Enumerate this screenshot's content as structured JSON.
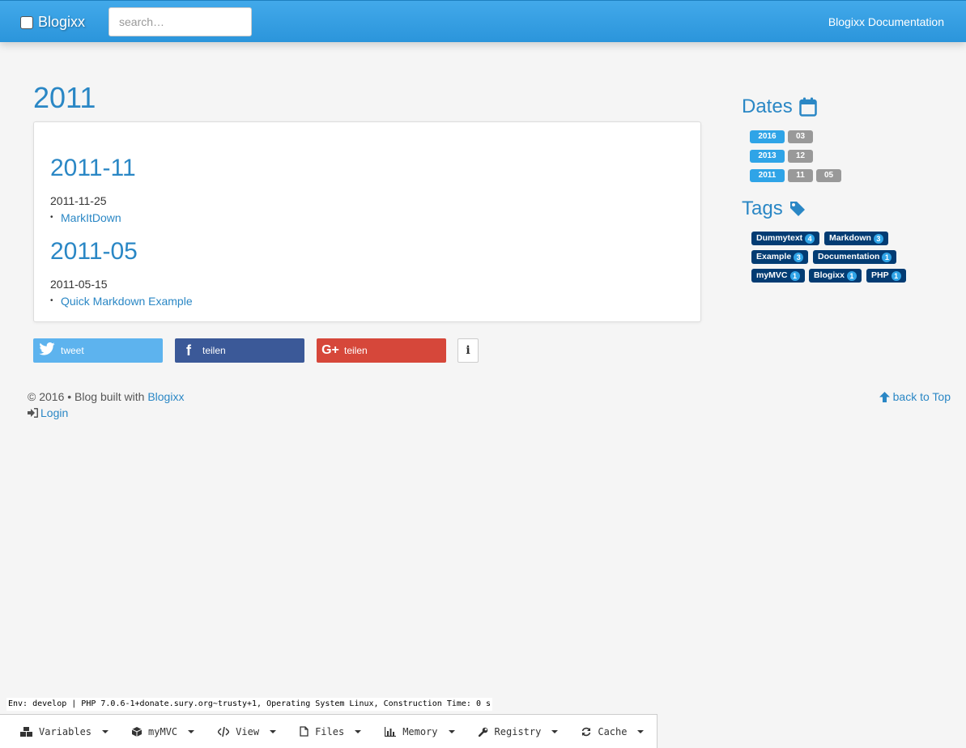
{
  "navbar": {
    "brand": "Blogixx",
    "search_placeholder": "search…",
    "doc_link": "Blogixx Documentation"
  },
  "page_title": "2011",
  "archive": [
    {
      "heading": "2011-11",
      "date": "2011-11-25",
      "posts": [
        "MarkItDown"
      ]
    },
    {
      "heading": "2011-05",
      "date": "2011-05-15",
      "posts": [
        "Quick Markdown Example"
      ]
    }
  ],
  "share": {
    "tweet": "tweet",
    "facebook": "teilen",
    "googleplus": "teilen",
    "info_icon": "info-icon"
  },
  "sidebar": {
    "dates_title": "Dates",
    "dates": [
      {
        "year": "2016",
        "months": [
          "03"
        ]
      },
      {
        "year": "2013",
        "months": [
          "12"
        ]
      },
      {
        "year": "2011",
        "months": [
          "11",
          "05"
        ]
      }
    ],
    "tags_title": "Tags",
    "tags": [
      {
        "name": "Dummytext",
        "count": "4"
      },
      {
        "name": "Markdown",
        "count": "3"
      },
      {
        "name": "Example",
        "count": "3"
      },
      {
        "name": "Documentation",
        "count": "1"
      },
      {
        "name": "myMVC",
        "count": "1"
      },
      {
        "name": "Blogixx",
        "count": "1"
      },
      {
        "name": "PHP",
        "count": "1"
      }
    ]
  },
  "footer": {
    "copyright": "© 2016 • Blog built with ",
    "built_link": "Blogixx",
    "login": "Login",
    "back_to_top": "back to Top"
  },
  "debug": {
    "env_line": "Env: develop | PHP 7.0.6-1+donate.sury.org~trusty+1, Operating System Linux, Construction Time: 0 s",
    "menus": [
      "Variables",
      "myMVC",
      "View",
      "Files",
      "Memory",
      "Registry",
      "Cache"
    ]
  },
  "colors": {
    "accent": "#2fa4e7",
    "tag_bg": "#033c73",
    "link": "#2a87c5"
  }
}
